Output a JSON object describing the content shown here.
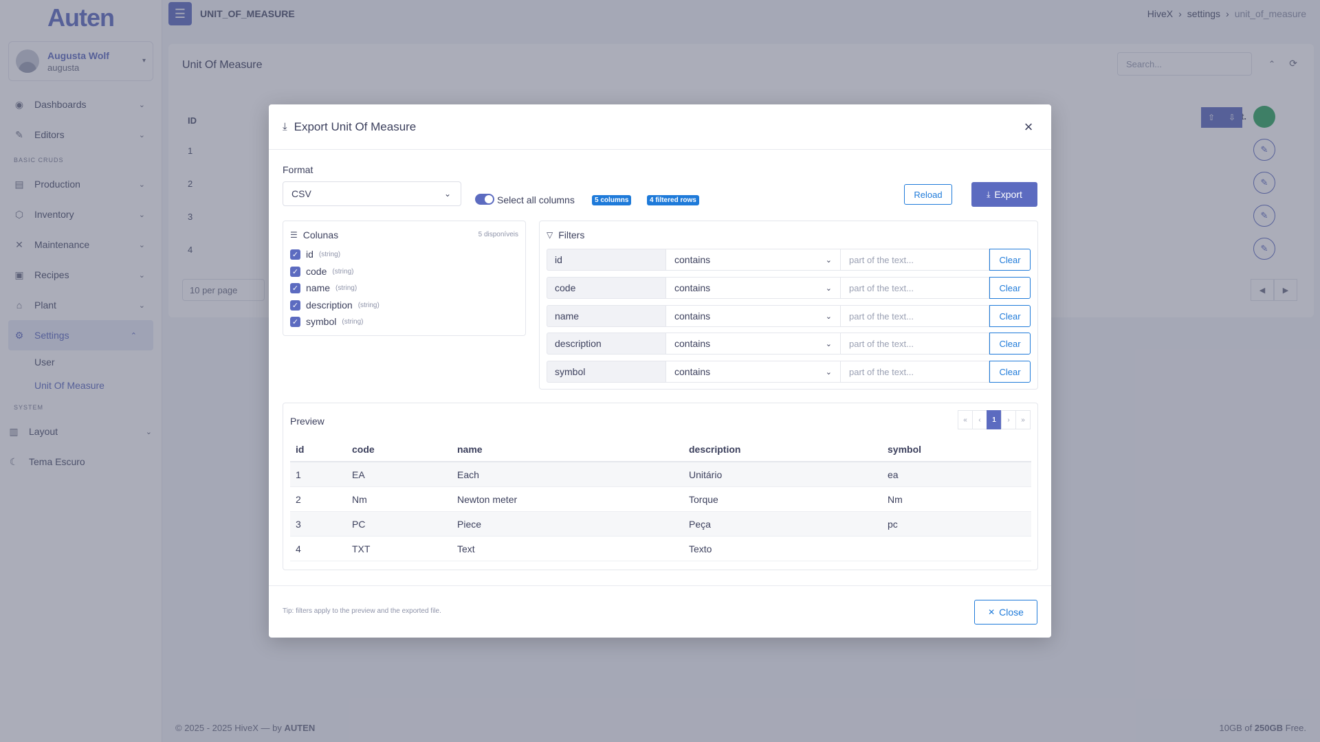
{
  "sidebar": {
    "logo": "Auten",
    "user": {
      "name": "Augusta Wolf",
      "login": "augusta"
    },
    "items": [
      {
        "label": "Dashboards",
        "icon": "gauge-icon"
      },
      {
        "label": "Editors",
        "icon": "edit-icon"
      }
    ],
    "section_basic": "BASIC CRUDS",
    "crud_items": [
      {
        "label": "Production"
      },
      {
        "label": "Inventory"
      },
      {
        "label": "Maintenance"
      },
      {
        "label": "Recipes"
      },
      {
        "label": "Plant"
      },
      {
        "label": "Settings"
      }
    ],
    "settings_sub": [
      {
        "label": "User"
      },
      {
        "label": "Unit Of Measure"
      }
    ],
    "section_system": "SYSTEM",
    "system_items": [
      {
        "label": "Layout"
      },
      {
        "label": "Tema Escuro"
      }
    ]
  },
  "topbar": {
    "page_code": "UNIT_OF_MEASURE",
    "breadcrumb": [
      "HiveX",
      "settings",
      "unit_of_measure"
    ]
  },
  "background": {
    "title": "Unit Of Measure",
    "search_placeholder": "Search...",
    "id_header": "ID",
    "rows": [
      "1",
      "2",
      "3",
      "4"
    ],
    "act_label": "act.",
    "per_page": "10 per page"
  },
  "footer": {
    "left": "© 2025 - 2025 HiveX — by",
    "brand": "AUTEN",
    "right_prefix": "10GB of",
    "right_total": "250GB",
    "right_suffix": "Free."
  },
  "modal": {
    "title": "Export Unit Of Measure",
    "format_label": "Format",
    "format_value": "CSV",
    "select_all_label": "Select all columns",
    "badge_columns": "5 columns",
    "badge_rows": "4 filtered rows",
    "reload_label": "Reload",
    "export_label": "Export",
    "columns_title": "Colunas",
    "columns_available": "5 disponíveis",
    "columns": [
      {
        "name": "id",
        "type": "(string)"
      },
      {
        "name": "code",
        "type": "(string)"
      },
      {
        "name": "name",
        "type": "(string)"
      },
      {
        "name": "description",
        "type": "(string)"
      },
      {
        "name": "symbol",
        "type": "(string)"
      }
    ],
    "filters_title": "Filters",
    "filters": [
      {
        "field": "id",
        "op": "contains",
        "placeholder": "part of the text...",
        "clear": "Clear"
      },
      {
        "field": "code",
        "op": "contains",
        "placeholder": "part of the text...",
        "clear": "Clear"
      },
      {
        "field": "name",
        "op": "contains",
        "placeholder": "part of the text...",
        "clear": "Clear"
      },
      {
        "field": "description",
        "op": "contains",
        "placeholder": "part of the text...",
        "clear": "Clear"
      },
      {
        "field": "symbol",
        "op": "contains",
        "placeholder": "part of the text...",
        "clear": "Clear"
      }
    ],
    "preview_title": "Preview",
    "pager": [
      "«",
      "‹",
      "1",
      "›",
      "»"
    ],
    "table_headers": [
      "id",
      "code",
      "name",
      "description",
      "symbol"
    ],
    "table_rows": [
      [
        "1",
        "EA",
        "Each",
        "Unitário",
        "ea"
      ],
      [
        "2",
        "Nm",
        "Newton meter",
        "Torque",
        "Nm"
      ],
      [
        "3",
        "PC",
        "Piece",
        "Peça",
        "pc"
      ],
      [
        "4",
        "TXT",
        "Text",
        "Texto",
        ""
      ]
    ],
    "tip": "Tip: filters apply to the preview and the exported file.",
    "close_label": "Close"
  },
  "colors": {
    "primary": "#5c6bc0",
    "accent_blue": "#1e7ad9",
    "success": "#2ea760"
  }
}
